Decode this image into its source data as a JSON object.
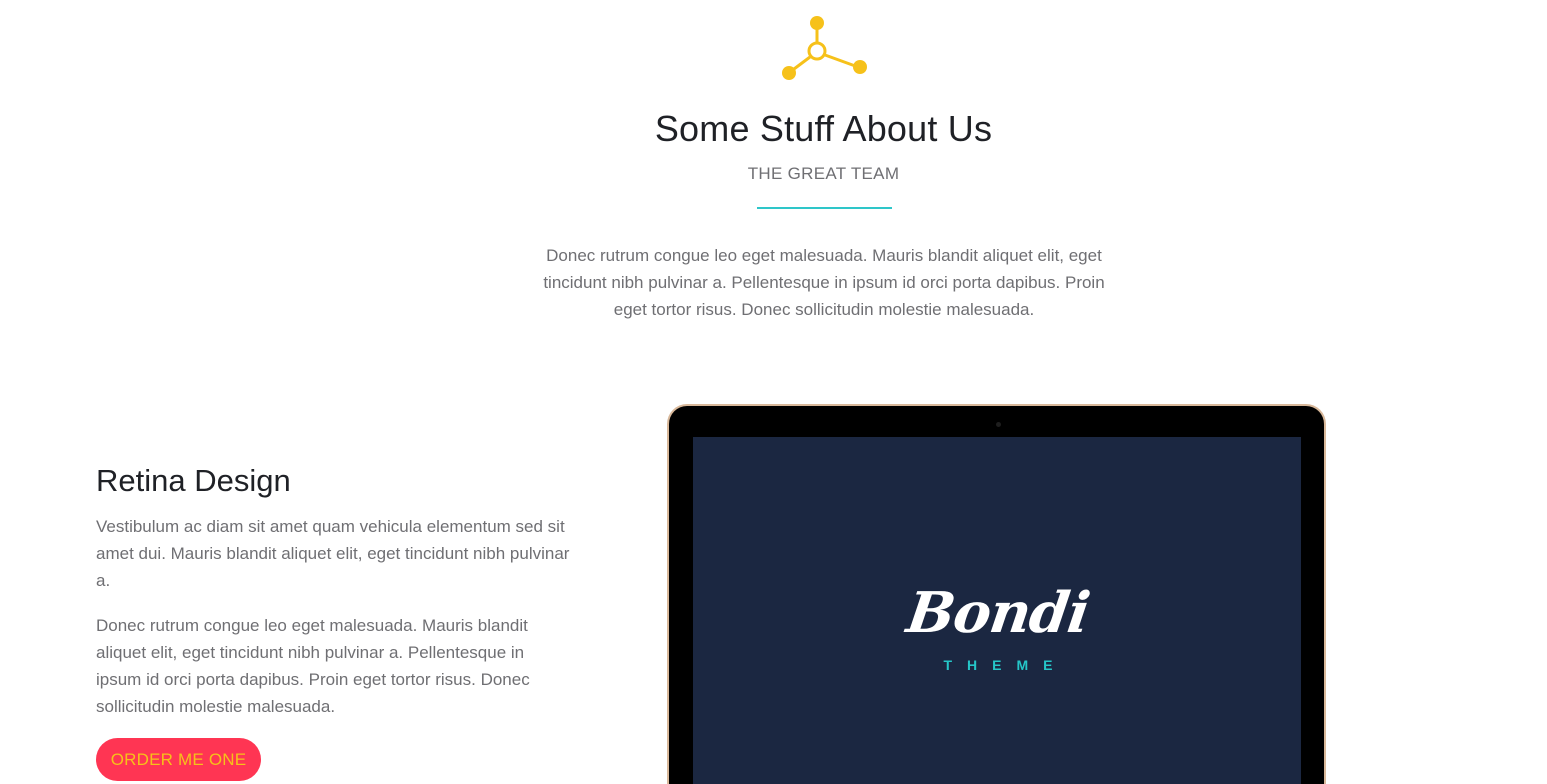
{
  "section": {
    "icon": "molecule-network-icon",
    "title": "Some Stuff About Us",
    "subtitle": "THE GREAT TEAM",
    "intro": "Donec rutrum congue leo eget malesuada. Mauris blandit aliquet elit, eget tincidunt nibh pulvinar a. Pellentesque in ipsum id orci porta dapibus. Proin eget tortor risus. Donec sollicitudin molestie malesuada."
  },
  "feature": {
    "title": "Retina Design",
    "paragraph1": "Vestibulum ac diam sit amet quam vehicula elementum sed sit amet dui. Mauris blandit aliquet elit, eget tincidunt nibh pulvinar a.",
    "paragraph2": "Donec rutrum congue leo eget malesuada. Mauris blandit aliquet elit, eget tincidunt nibh pulvinar a. Pellentesque in ipsum id orci porta dapibus. Proin eget tortor risus. Donec sollicitudin molestie malesuada.",
    "button_label": "ORDER ME ONE"
  },
  "device": {
    "brand_name": "Bondi",
    "brand_tagline": "THEME"
  },
  "colors": {
    "accent_yellow": "#f6c11a",
    "accent_teal": "#2ec6c9",
    "button_red": "#ff3553",
    "screen_navy": "#1b2741"
  }
}
